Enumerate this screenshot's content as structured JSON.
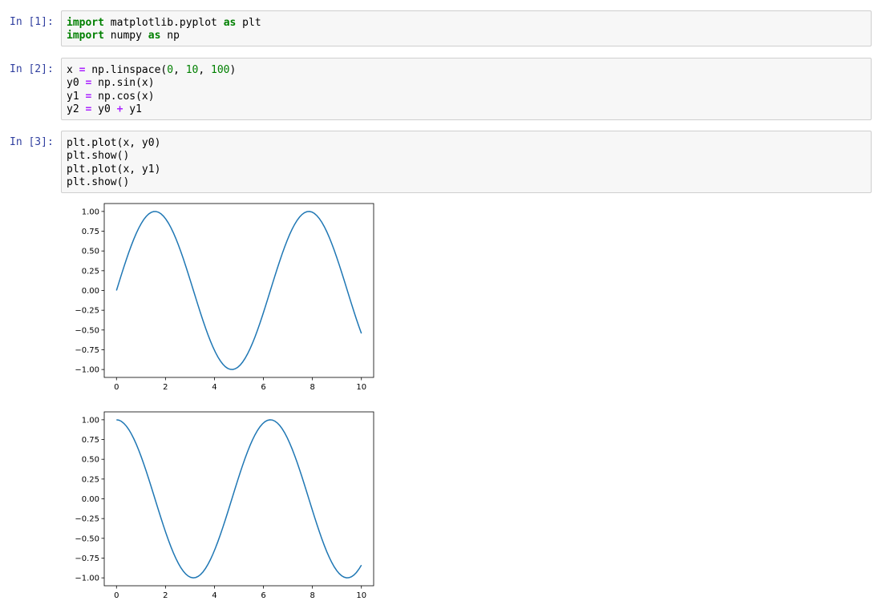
{
  "cells": [
    {
      "prompt": "In [1]:",
      "lines": [
        [
          {
            "t": "kw",
            "s": "import"
          },
          {
            "t": "plain",
            "s": " matplotlib.pyplot "
          },
          {
            "t": "kw",
            "s": "as"
          },
          {
            "t": "plain",
            "s": " plt"
          }
        ],
        [
          {
            "t": "kw",
            "s": "import"
          },
          {
            "t": "plain",
            "s": " numpy "
          },
          {
            "t": "kw",
            "s": "as"
          },
          {
            "t": "plain",
            "s": " np"
          }
        ]
      ]
    },
    {
      "prompt": "In [2]:",
      "lines": [
        [
          {
            "t": "plain",
            "s": "x "
          },
          {
            "t": "op",
            "s": "="
          },
          {
            "t": "plain",
            "s": " np.linspace("
          },
          {
            "t": "num",
            "s": "0"
          },
          {
            "t": "plain",
            "s": ", "
          },
          {
            "t": "num",
            "s": "10"
          },
          {
            "t": "plain",
            "s": ", "
          },
          {
            "t": "num",
            "s": "100"
          },
          {
            "t": "plain",
            "s": ")"
          }
        ],
        [
          {
            "t": "plain",
            "s": "y0 "
          },
          {
            "t": "op",
            "s": "="
          },
          {
            "t": "plain",
            "s": " np.sin(x)"
          }
        ],
        [
          {
            "t": "plain",
            "s": "y1 "
          },
          {
            "t": "op",
            "s": "="
          },
          {
            "t": "plain",
            "s": " np.cos(x)"
          }
        ],
        [
          {
            "t": "plain",
            "s": "y2 "
          },
          {
            "t": "op",
            "s": "="
          },
          {
            "t": "plain",
            "s": " y0 "
          },
          {
            "t": "op",
            "s": "+"
          },
          {
            "t": "plain",
            "s": " y1"
          }
        ]
      ]
    },
    {
      "prompt": "In [3]:",
      "lines": [
        [
          {
            "t": "plain",
            "s": "plt.plot(x, y0)"
          }
        ],
        [
          {
            "t": "plain",
            "s": "plt.show()"
          }
        ],
        [
          {
            "t": "plain",
            "s": "plt.plot(x, y1)"
          }
        ],
        [
          {
            "t": "plain",
            "s": "plt.show()"
          }
        ]
      ]
    }
  ],
  "chart_data": [
    {
      "type": "line",
      "function": "sin",
      "x_range": [
        0,
        10
      ],
      "n_points": 100,
      "xlim": [
        -0.5,
        10.5
      ],
      "ylim": [
        -1.1,
        1.1
      ],
      "x_ticks": [
        0,
        2,
        4,
        6,
        8,
        10
      ],
      "x_tick_labels": [
        "0",
        "2",
        "4",
        "6",
        "8",
        "10"
      ],
      "y_ticks": [
        1.0,
        0.75,
        0.5,
        0.25,
        0.0,
        -0.25,
        -0.5,
        -0.75,
        -1.0
      ],
      "y_tick_labels": [
        "1.00",
        "0.75",
        "0.50",
        "0.25",
        "0.00",
        "−0.25",
        "−0.50",
        "−0.75",
        "−1.00"
      ],
      "title": "",
      "xlabel": "",
      "ylabel": "",
      "color": "#1f77b4",
      "grid": false
    },
    {
      "type": "line",
      "function": "cos",
      "x_range": [
        0,
        10
      ],
      "n_points": 100,
      "xlim": [
        -0.5,
        10.5
      ],
      "ylim": [
        -1.1,
        1.1
      ],
      "x_ticks": [
        0,
        2,
        4,
        6,
        8,
        10
      ],
      "x_tick_labels": [
        "0",
        "2",
        "4",
        "6",
        "8",
        "10"
      ],
      "y_ticks": [
        1.0,
        0.75,
        0.5,
        0.25,
        0.0,
        -0.25,
        -0.5,
        -0.75,
        -1.0
      ],
      "y_tick_labels": [
        "1.00",
        "0.75",
        "0.50",
        "0.25",
        "0.00",
        "−0.25",
        "−0.50",
        "−0.75",
        "−1.00"
      ],
      "title": "",
      "xlabel": "",
      "ylabel": "",
      "color": "#1f77b4",
      "grid": false
    }
  ]
}
